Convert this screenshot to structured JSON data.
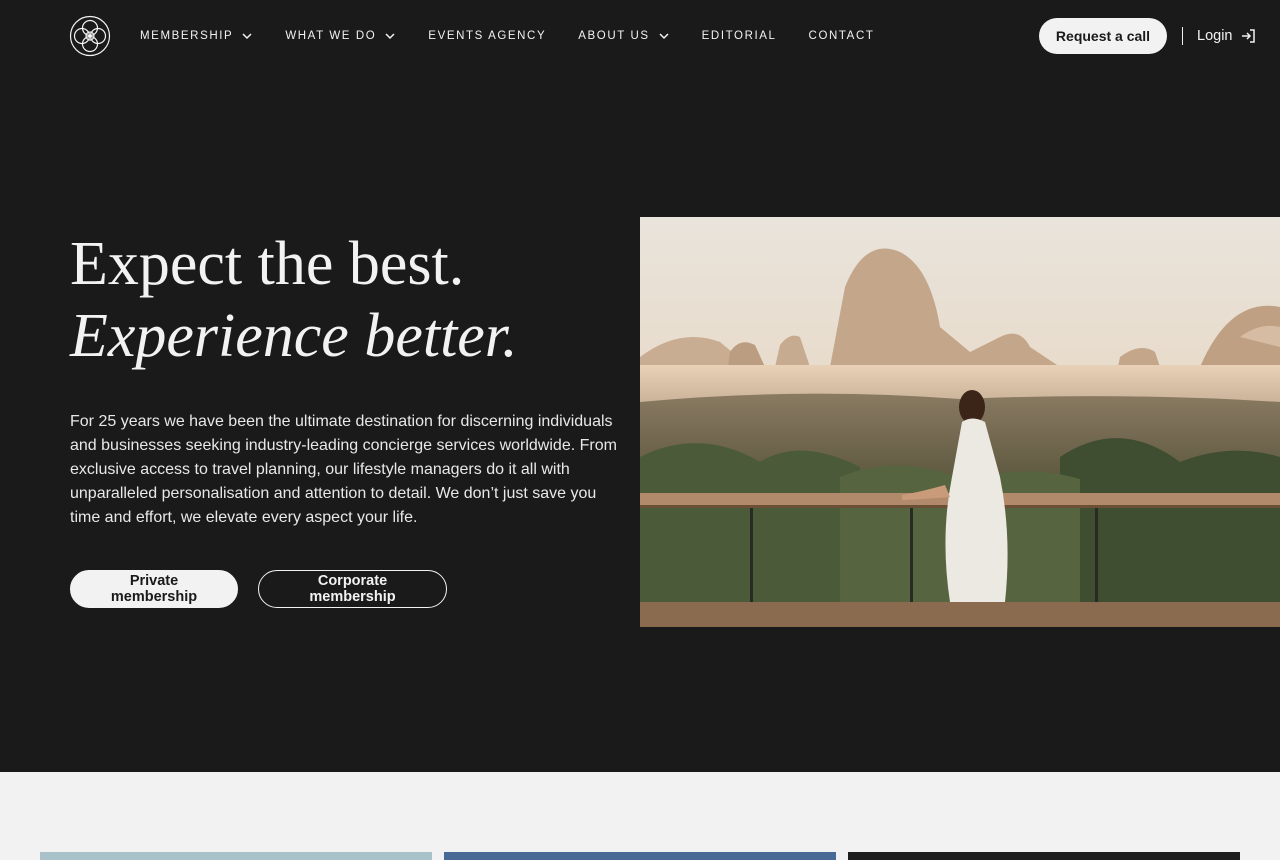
{
  "header": {
    "logo_icon": "monogram-logo-icon",
    "nav": [
      {
        "label": "MEMBERSHIP",
        "has_dropdown": true
      },
      {
        "label": "WHAT WE DO",
        "has_dropdown": true
      },
      {
        "label": "EVENTS AGENCY",
        "has_dropdown": false
      },
      {
        "label": "ABOUT US",
        "has_dropdown": true
      },
      {
        "label": "EDITORIAL",
        "has_dropdown": false
      },
      {
        "label": "CONTACT",
        "has_dropdown": false
      }
    ],
    "request_call_label": "Request a call",
    "login_label": "Login",
    "login_icon": "login-arrow-icon"
  },
  "hero": {
    "title_line1": "Expect the best.",
    "title_line2": "Experience better.",
    "description": "For 25 years we have been the ultimate destination for discerning individuals and businesses seeking industry-leading concierge services worldwide. From exclusive access to travel planning, our lifestyle managers do it all with unparalleled personalisation and attention to detail. We don’t just save you time and effort, we elevate every aspect your life.",
    "primary_button": "Private membership",
    "secondary_button": "Corporate membership"
  },
  "colors": {
    "background": "#1a1a1a",
    "text": "#f2f2f2",
    "lower_section": "#f2f2f2"
  }
}
